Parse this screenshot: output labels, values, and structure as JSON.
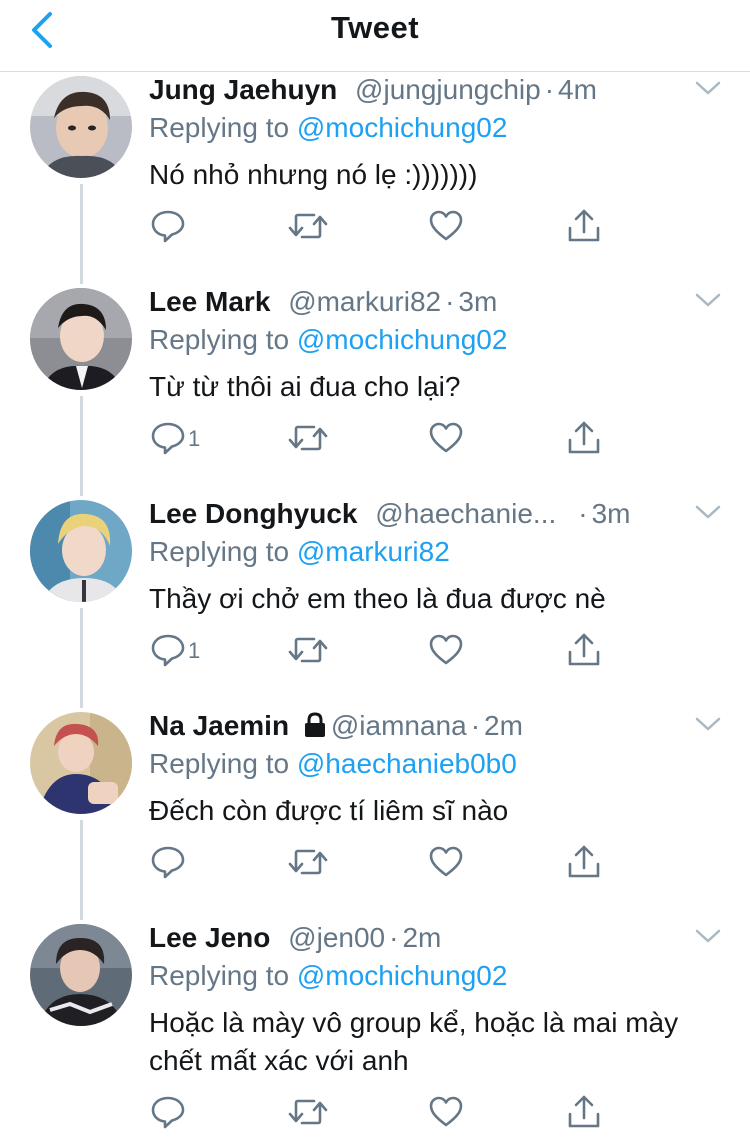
{
  "nav": {
    "title": "Tweet"
  },
  "tweets": [
    {
      "name": "Jung Jaehuyn",
      "handle": "@jungjungchip",
      "dot": "·",
      "time": "4m",
      "replying_prefix": "Replying to",
      "replying_to": "@mochichung02",
      "text": "Nó nhỏ nhưng nó lẹ :)))))))",
      "reply_count": ""
    },
    {
      "name": "Lee Mark",
      "handle": "@markuri82",
      "dot": "·",
      "time": "3m",
      "replying_prefix": "Replying to",
      "replying_to": "@mochichung02",
      "text": "Từ từ thôi ai đua cho lại?",
      "reply_count": "1"
    },
    {
      "name": "Lee Donghyuck",
      "handle": "@haechanie...",
      "dot": "·",
      "time": "3m",
      "replying_prefix": "Replying to",
      "replying_to": "@markuri82",
      "text": "Thầy ơi chở em theo là đua được nè",
      "reply_count": "1"
    },
    {
      "name": "Na Jaemin",
      "handle": "@iamnana",
      "dot": "·",
      "time": "2m",
      "replying_prefix": "Replying to",
      "replying_to": "@haechanieb0b0",
      "text": "Đếch còn được tí liêm sĩ nào",
      "reply_count": "",
      "locked": true
    },
    {
      "name": "Lee Jeno",
      "handle": "@jen00",
      "dot": "·",
      "time": "2m",
      "replying_prefix": "Replying to",
      "replying_to": "@mochichung02",
      "text": "Hoặc là mày vô group kể, hoặc là mai mày chết mất xác với anh",
      "reply_count": ""
    }
  ],
  "colors": {
    "accent": "#1da1f2",
    "secondary_text": "#657786",
    "primary_text": "#14171a",
    "divider": "#cfd9de"
  }
}
